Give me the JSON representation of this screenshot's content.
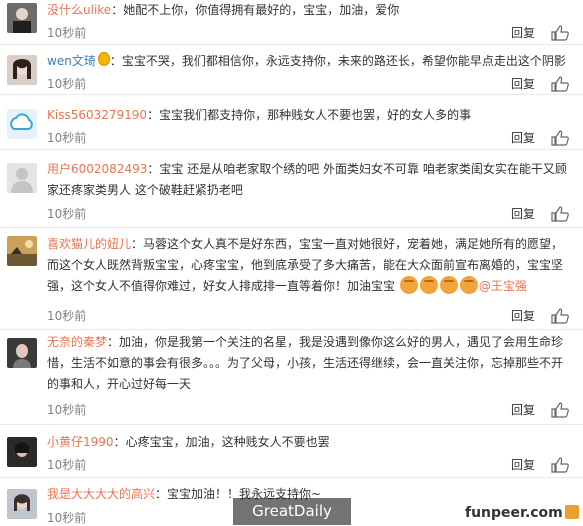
{
  "comments": [
    {
      "user": "没什么ulike",
      "sep": "：",
      "text": "她配不上你，你值得拥有最好的，宝宝，加油，爱你",
      "time": "10秒前",
      "reply": "回复"
    },
    {
      "user": "wen文琦",
      "sep": "：",
      "text": "宝宝不哭，我们都相信你，永远支持你，未来的路还长，希望你能早点走出这个阴影",
      "time": "10秒前",
      "reply": "回复"
    },
    {
      "user": "Kiss5603279190",
      "sep": "：",
      "text": "宝宝我们都支持你，那种贱女人不要也罢，好的女人多的事",
      "time": "10秒前",
      "reply": "回复"
    },
    {
      "user": "用户6002082493",
      "sep": "：",
      "text": "宝宝 还是从咱老家取个绣的吧  外面类妇女不可靠  咱老家类闺女实在能干又顾家还疼家类男人 这个破鞋赶紧扔老吧",
      "time": "10秒前",
      "reply": "回复"
    },
    {
      "user": "喜欢猫儿的妞儿",
      "sep": "：",
      "text": "马蓉这个女人真不是好东西，宝宝一直对她很好，宠着她，满足她所有的愿望，而这个女人既然背叛宝宝，心疼宝宝，他到底承受了多大痛苦，能在大众面前宣布离婚的，宝宝坚强，这个女人不值得你难过，好女人排成排一直等着你！加油宝宝",
      "mention": "@王宝强",
      "time": "10秒前",
      "reply": "回复"
    },
    {
      "user": "无奈的秦梦",
      "sep": "：",
      "text": "加油，你是我第一个关注的名星，我是没遇到像你这么好的男人，遇见了会用生命珍惜，生活不如意的事会有很多。。。为了父母，小孩，生活还得继续，会一直关注你，忘掉那些不开的事和人，开心过好每一天",
      "time": "10秒前",
      "reply": "回复"
    },
    {
      "user": "小黄仔1990",
      "sep": "：",
      "text": "心疼宝宝，加油，这种贱女人不要也罢",
      "time": "10秒前",
      "reply": "回复"
    },
    {
      "user": "我是大大大大的高兴",
      "sep": "：",
      "text": "宝宝加油！！我永远支持你~",
      "time": "10秒前",
      "reply": "回复"
    }
  ],
  "watermark_left": "GreatDaily",
  "watermark_right": "funpeer.com"
}
